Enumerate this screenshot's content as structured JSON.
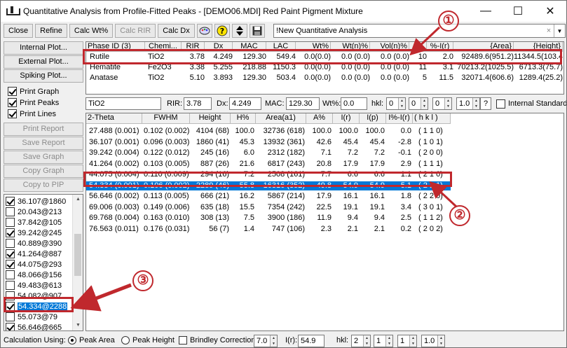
{
  "window": {
    "title": "Quantitative Analysis from Profile-Fitted Peaks - [DEMO06.MDI] Red Paint Pigment Mixture",
    "controls": {
      "minimize": "—",
      "maximize": "☐",
      "close": "✕"
    }
  },
  "toolbar": {
    "close_label": "Close",
    "refine_label": "Refine",
    "calc_wt_label": "Calc Wt%",
    "calc_rir_label": "Calc RIR",
    "calc_dx_label": "Calc Dx",
    "help_label": "?",
    "combo_value": "!New Quantitative Analysis",
    "combo_clear": "×",
    "combo_arrow": "▼"
  },
  "left_panel": {
    "buttons": [
      "Internal Plot...",
      "External Plot...",
      "Spiking Plot..."
    ],
    "checks": [
      {
        "label": "Print Graph",
        "checked": true
      },
      {
        "label": "Print Peaks",
        "checked": true
      },
      {
        "label": "Print Lines",
        "checked": true
      }
    ],
    "disabled_buttons": [
      "Print Report",
      "Save Report",
      "Save Graph",
      "Copy Graph",
      "Copy to PIP"
    ]
  },
  "peak_list": [
    {
      "label": "36.107@1860",
      "checked": true
    },
    {
      "label": "20.043@213",
      "checked": false
    },
    {
      "label": "37.842@105",
      "checked": false
    },
    {
      "label": "39.242@245",
      "checked": true
    },
    {
      "label": "40.889@390",
      "checked": false
    },
    {
      "label": "41.264@887",
      "checked": true
    },
    {
      "label": "44.075@293",
      "checked": true
    },
    {
      "label": "48.066@156",
      "checked": false
    },
    {
      "label": "49.483@613",
      "checked": false
    },
    {
      "label": "54.082@907",
      "checked": false
    },
    {
      "label": "54.334@2288",
      "checked": true,
      "selected": true
    },
    {
      "label": "55.073@79",
      "checked": false
    },
    {
      "label": "56.646@665",
      "checked": true
    }
  ],
  "phase_table": {
    "headers": [
      "Phase ID (3)",
      "Chemi...",
      "RIR",
      "Dx",
      "MAC",
      "LAC",
      "Wt%",
      "Wt(n)%",
      "Vol(n)%",
      "#L",
      "%-I(r)",
      "{Area}",
      "{Height}"
    ],
    "rows": [
      [
        "Rutile",
        "TiO2",
        "3.78",
        "4.249",
        "129.30",
        "549.4",
        "0.0(0.0)",
        "0.0 (0.0)",
        "0.0 (0.0)",
        "10",
        "2.0",
        "92489.6(951.2)",
        "11344.5(103.4)"
      ],
      [
        "Hematite",
        "Fe2O3",
        "3.38",
        "5.255",
        "218.88",
        "1150.3",
        "0.0(0.0)",
        "0.0 (0.0)",
        "0.0 (0.0)",
        "11",
        "3.1",
        "70213.2(1025.5)",
        "6713.3(75.7)"
      ],
      [
        "Anatase",
        "TiO2",
        "5.10",
        "3.893",
        "129.30",
        "503.4",
        "0.0(0.0)",
        "0.0 (0.0)",
        "0.0 (0.0)",
        "5",
        "11.5",
        "32071.4(606.6)",
        "1289.4(25.2)"
      ]
    ]
  },
  "params": {
    "phase": "TiO2",
    "rir_label": "RIR:",
    "rir": "3.78",
    "dx_label": "Dx:",
    "dx": "4.249",
    "mac_label": "MAC:",
    "mac": "129.30",
    "wt_label": "Wt%:",
    "wt": "0.0",
    "hkl_label": "hkl:",
    "h": "0",
    "k": "0",
    "l": "0",
    "scale": "1.0",
    "help": "?",
    "internal_standard_label": "Internal Standard"
  },
  "peak_table": {
    "headers": [
      "2-Theta",
      "FWHM",
      "Height",
      "H%",
      "Area(a1)",
      "A%",
      "I(r)",
      "I(p)",
      "I%-I(r)",
      "( h k l )"
    ],
    "rows": [
      [
        "27.488 (0.001)",
        "0.102 (0.002)",
        "4104 (68)",
        "100.0",
        "32736 (618)",
        "100.0",
        "100.0",
        "100.0",
        "0.0",
        "( 1 1 0)"
      ],
      [
        "36.107 (0.001)",
        "0.096 (0.003)",
        "1860 (41)",
        "45.3",
        "13932 (361)",
        "42.6",
        "45.4",
        "45.4",
        "-2.8",
        "( 1 0 1)"
      ],
      [
        "39.242 (0.004)",
        "0.122 (0.012)",
        "245 (16)",
        "6.0",
        "2312 (182)",
        "7.1",
        "7.2",
        "7.2",
        "-0.1",
        "( 2 0 0)"
      ],
      [
        "41.264 (0.002)",
        "0.103 (0.005)",
        "887 (26)",
        "21.6",
        "6817 (243)",
        "20.8",
        "17.9",
        "17.9",
        "2.9",
        "( 1 1 1)"
      ],
      [
        "44.075 (0.004)",
        "0.110 (0.009)",
        "294 (16)",
        "7.2",
        "2508 (161)",
        "7.7",
        "6.6",
        "6.6",
        "1.1",
        "( 2 1 0)"
      ],
      [
        "54.334 (0.001)",
        "0.106 (0.002)",
        "2289 (46)",
        "55.8",
        "16316 (352)",
        "49.8",
        "54.9",
        "54.9",
        "-5.1",
        "( 2 1 1)"
      ],
      [
        "56.646 (0.002)",
        "0.113 (0.005)",
        "666 (21)",
        "16.2",
        "5867 (214)",
        "17.9",
        "16.1",
        "16.1",
        "1.8",
        "( 2 2 0)"
      ],
      [
        "69.006 (0.003)",
        "0.149 (0.006)",
        "635 (18)",
        "15.5",
        "7354 (242)",
        "22.5",
        "19.1",
        "19.1",
        "3.4",
        "( 3 0 1)"
      ],
      [
        "69.768 (0.004)",
        "0.163 (0.010)",
        "308 (13)",
        "7.5",
        "3900 (186)",
        "11.9",
        "9.4",
        "9.4",
        "2.5",
        "( 1 1 2)"
      ],
      [
        "76.563 (0.011)",
        "0.176 (0.031)",
        "56 (7)",
        "1.4",
        "747 (106)",
        "2.3",
        "2.1",
        "2.1",
        "0.2",
        "( 2 0 2)"
      ]
    ],
    "selected_row": 5
  },
  "statusbar": {
    "calc_using_label": "Calculation Using:",
    "peak_area_label": "Peak Area",
    "peak_height_label": "Peak Height",
    "brindley_label": "Brindley Correction",
    "brindley_value": "7.0",
    "ir_label": "I(r):",
    "ir_value": "54.9",
    "hkl_label": "hkl:",
    "h": "2",
    "k": "1",
    "l": "1",
    "scale": "1.0"
  },
  "annotations": [
    "①",
    "②",
    "③"
  ],
  "colors": {
    "annotation": "#c0282d",
    "selection": "#0078d7"
  }
}
